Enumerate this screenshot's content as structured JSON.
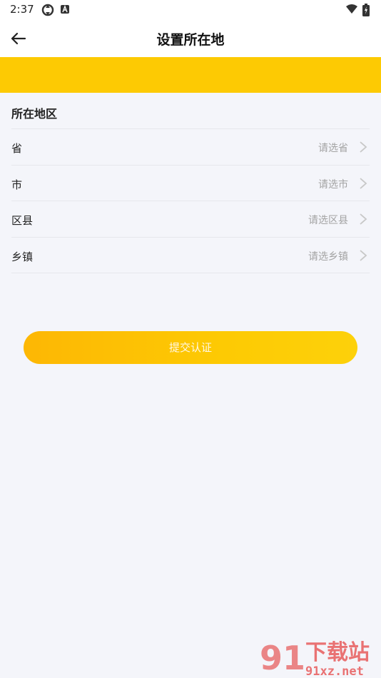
{
  "status_bar": {
    "time": "2:37",
    "icons": [
      "sync-icon",
      "app-a-icon",
      "wifi-icon",
      "battery-charging-icon"
    ]
  },
  "header": {
    "title": "设置所在地",
    "back_icon": "back-arrow-icon"
  },
  "banner": {
    "color": "#fdca03"
  },
  "region": {
    "section_title": "所在地区",
    "rows": [
      {
        "label": "省",
        "placeholder": "请选省"
      },
      {
        "label": "市",
        "placeholder": "请选市"
      },
      {
        "label": "区县",
        "placeholder": "请选区县"
      },
      {
        "label": "乡镇",
        "placeholder": "请选乡镇"
      }
    ]
  },
  "submit_button": {
    "label": "提交认证",
    "color": "#fdc204"
  },
  "watermark": {
    "text_main": "下载站",
    "text_sub": "91xz.net",
    "badge": "91"
  }
}
